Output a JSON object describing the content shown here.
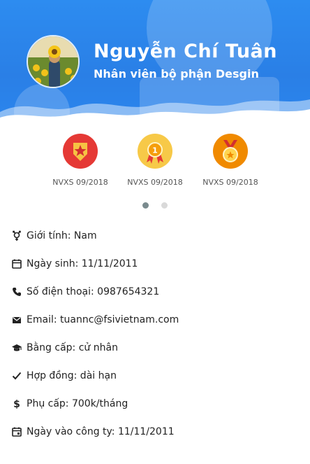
{
  "profile": {
    "name": "Nguyễn Chí Tuân",
    "role": "Nhân viên bộ phận Desgin",
    "header_color": "#2d8cf0"
  },
  "badges": [
    {
      "label": "NVXS 09/2018",
      "icon": "red-star-badge-icon",
      "color": "#e53935"
    },
    {
      "label": "NVXS 09/2018",
      "icon": "gold-ribbon-medal-icon",
      "color": "#f5b82e"
    },
    {
      "label": "NVXS 09/2018",
      "icon": "orange-medal-icon",
      "color": "#f08a00"
    }
  ],
  "carousel": {
    "pages": 2,
    "active": 1
  },
  "info": [
    {
      "icon": "gender-icon",
      "text": "Giới tính: Nam"
    },
    {
      "icon": "calendar-icon",
      "text": "Ngày sinh: 11/11/2011"
    },
    {
      "icon": "phone-icon",
      "text": "Số điện thoại: 0987654321"
    },
    {
      "icon": "email-icon",
      "text": "Email: tuannc@fsivietnam.com"
    },
    {
      "icon": "graduation-cap-icon",
      "text": "Bằng cấp: cử nhân"
    },
    {
      "icon": "checkmark-icon",
      "text": "Hợp đồng: dài hạn"
    },
    {
      "icon": "dollar-icon",
      "text": "Phụ cấp: 700k/tháng"
    },
    {
      "icon": "calendar-start-icon",
      "text": "Ngày vào công ty: 11/11/2011"
    }
  ]
}
